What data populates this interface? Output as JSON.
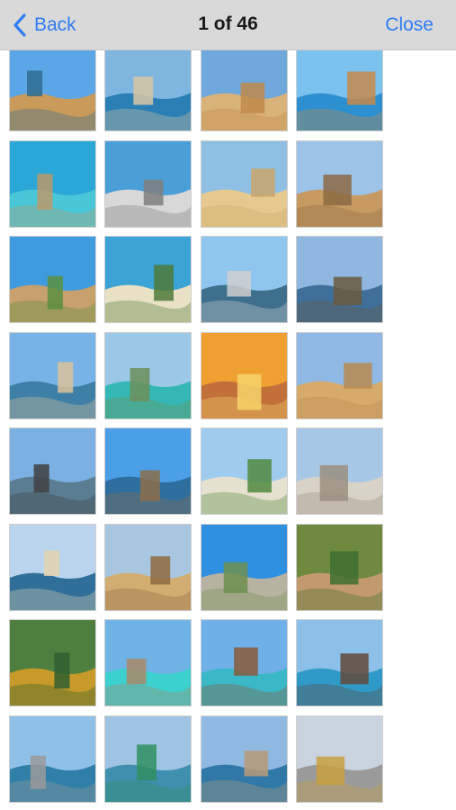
{
  "nav": {
    "back_label": "Back",
    "title": "1 of 46",
    "close_label": "Close"
  },
  "thumbnails": [
    {
      "name": "photo-harbour-church",
      "sky": "#5aa6e6",
      "ground": "#c99a5a",
      "accent": "#2f6b8f"
    },
    {
      "name": "photo-bay-aerial",
      "sky": "#7fb6e0",
      "ground": "#2a7fb5",
      "accent": "#d8c7a3"
    },
    {
      "name": "photo-cathedral-facade",
      "sky": "#6fa8dc",
      "ground": "#d9b27a",
      "accent": "#c08a4a"
    },
    {
      "name": "photo-azure-window",
      "sky": "#7cc2ef",
      "ground": "#2b8fd0",
      "accent": "#c7894a"
    },
    {
      "name": "photo-lagoon-boats",
      "sky": "#2aa7d6",
      "ground": "#49c7d9",
      "accent": "#b89a6a"
    },
    {
      "name": "photo-sea-cave",
      "sky": "#4a9fd8",
      "ground": "#d8d8d8",
      "accent": "#7f7f7f"
    },
    {
      "name": "photo-domed-church",
      "sky": "#8fbfe3",
      "ground": "#e6c98f",
      "accent": "#c9a56a"
    },
    {
      "name": "photo-narrow-street",
      "sky": "#9ec3e8",
      "ground": "#c79a62",
      "accent": "#8c6a44"
    },
    {
      "name": "photo-hilltop-citadel",
      "sky": "#3f9be0",
      "ground": "#c7a06c",
      "accent": "#5a8f3f"
    },
    {
      "name": "photo-beach-cliffs",
      "sky": "#3ba3d6",
      "ground": "#e9e1c5",
      "accent": "#4f7a3a"
    },
    {
      "name": "photo-city-towers",
      "sky": "#8fc6ef",
      "ground": "#3e6f8c",
      "accent": "#cfcfcf"
    },
    {
      "name": "photo-balcony-harbour",
      "sky": "#8fb7df",
      "ground": "#3f6f9a",
      "accent": "#6b5a40"
    },
    {
      "name": "photo-seafront-city",
      "sky": "#78b3e8",
      "ground": "#3d7fa6",
      "accent": "#d9c29a"
    },
    {
      "name": "photo-turquoise-bay",
      "sky": "#9cc8e8",
      "ground": "#35b8b5",
      "accent": "#6c8f5a"
    },
    {
      "name": "photo-colosseum-sunset",
      "sky": "#f0a030",
      "ground": "#c2703a",
      "accent": "#f6d36a"
    },
    {
      "name": "photo-city-skyline-dome",
      "sky": "#8fb9e4",
      "ground": "#d6aa6a",
      "accent": "#b98a50"
    },
    {
      "name": "photo-stone-bridge",
      "sky": "#7ab1e2",
      "ground": "#5a7d92",
      "accent": "#3f3f3f"
    },
    {
      "name": "photo-lamp-post-coast",
      "sky": "#4a9fe6",
      "ground": "#2f6f9f",
      "accent": "#8c6d4a"
    },
    {
      "name": "photo-palace-garden",
      "sky": "#9fcbee",
      "ground": "#e6e0d0",
      "accent": "#4f8a3f"
    },
    {
      "name": "photo-ancient-columns",
      "sky": "#a7c7e6",
      "ground": "#d9d2c6",
      "accent": "#9a8f80"
    },
    {
      "name": "photo-marina-boats",
      "sky": "#b9d4ec",
      "ground": "#2f6f9a",
      "accent": "#e0d4b0"
    },
    {
      "name": "photo-fortified-town",
      "sky": "#a9c6e0",
      "ground": "#d2ad72",
      "accent": "#8f6a40"
    },
    {
      "name": "photo-megalithic-temple",
      "sky": "#2f8fe0",
      "ground": "#b8b2a2",
      "accent": "#6f8f4f"
    },
    {
      "name": "photo-cave-garden",
      "sky": "#6f8a3f",
      "ground": "#c39a6e",
      "accent": "#3f6f2f"
    },
    {
      "name": "photo-golden-pavilion",
      "sky": "#4f7f3f",
      "ground": "#c79a2a",
      "accent": "#2f5f2f"
    },
    {
      "name": "photo-turquoise-shore",
      "sky": "#6fb3e6",
      "ground": "#3cd0cf",
      "accent": "#a98a6a"
    },
    {
      "name": "photo-rocky-lagoon",
      "sky": "#6fb0e8",
      "ground": "#3ab8c8",
      "accent": "#8a5a3a"
    },
    {
      "name": "photo-island-cove",
      "sky": "#8dc0e8",
      "ground": "#2f9ac8",
      "accent": "#5f4a3a"
    },
    {
      "name": "photo-rocky-coast",
      "sky": "#8fc0e8",
      "ground": "#2f7fa8",
      "accent": "#9a9a9a"
    },
    {
      "name": "photo-fishing-boat",
      "sky": "#9fc3e2",
      "ground": "#3f8fb0",
      "accent": "#2f8f5f"
    },
    {
      "name": "photo-rock-arch",
      "sky": "#8fb9e0",
      "ground": "#2f78a8",
      "accent": "#b89a7a"
    },
    {
      "name": "photo-palace-of-fine-arts",
      "sky": "#c9d4e0",
      "ground": "#9a9a9a",
      "accent": "#c9a040"
    }
  ]
}
